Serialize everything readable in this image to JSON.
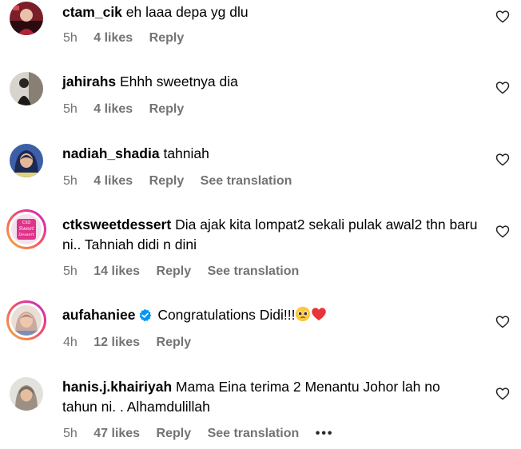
{
  "comments": [
    {
      "username": "ctam_cik",
      "text": "eh laaa depa yg dlu",
      "time": "5h",
      "likes": "4 likes",
      "reply": "Reply",
      "avatar_icon": "profile-photo"
    },
    {
      "username": "jahirahs",
      "text": "Ehhh sweetnya dia",
      "time": "5h",
      "likes": "4 likes",
      "reply": "Reply",
      "avatar_icon": "profile-photo"
    },
    {
      "username": "nadiah_shadia",
      "text": "tahniah",
      "time": "5h",
      "likes": "4 likes",
      "reply": "Reply",
      "see_translation": "See translation",
      "avatar_icon": "profile-photo"
    },
    {
      "username": "ctksweetdessert",
      "text": "Dia ajak kita lompat2 sekali pulak awal2 thn baru ni.. Tahniah didi n dini",
      "time": "5h",
      "likes": "14 likes",
      "reply": "Reply",
      "see_translation": "See translation",
      "avatar_icon": "story-ring-profile-photo",
      "avatar_text": [
        "CSD",
        "Sweet",
        "Dessert"
      ]
    },
    {
      "username": "aufahaniee",
      "text": "Congratulations Didi!!!",
      "emojis": [
        "pleading-face-emoji",
        "red-heart-emoji"
      ],
      "verified": true,
      "time": "4h",
      "likes": "12 likes",
      "reply": "Reply",
      "avatar_icon": "story-ring-profile-photo"
    },
    {
      "username": "hanis.j.khairiyah",
      "text": "Mama Eina terima 2 Menantu Johor lah no tahun ni. . Alhamdulillah",
      "time": "5h",
      "likes": "47 likes",
      "reply": "Reply",
      "see_translation": "See translation",
      "more": "•••",
      "avatar_icon": "profile-photo"
    }
  ],
  "colors": {
    "text": "#000000",
    "meta": "#737373",
    "verified": "#0095f6",
    "heart_outline": "#262626",
    "story_ring": [
      "#f9b233",
      "#f2496e",
      "#c026d3"
    ]
  }
}
